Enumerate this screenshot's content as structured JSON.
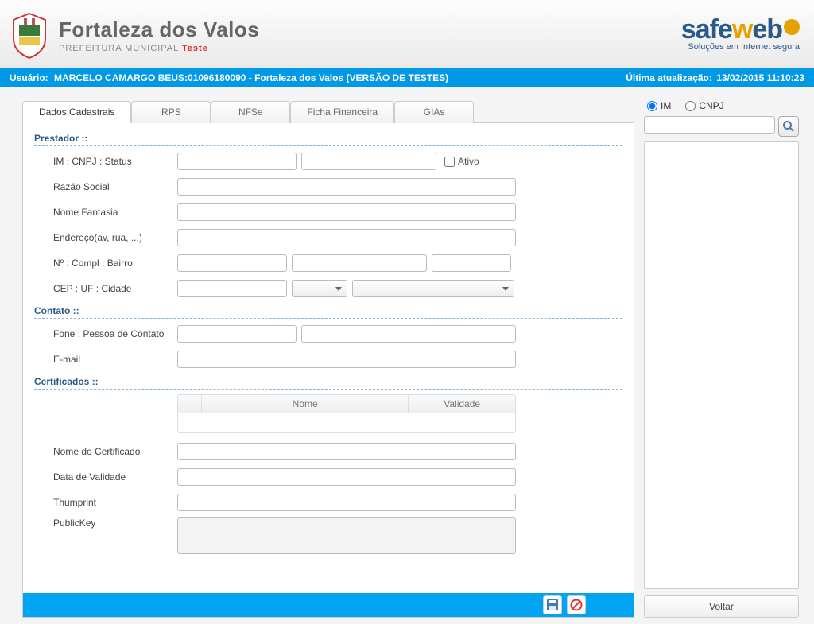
{
  "header": {
    "city": "Fortaleza dos Valos",
    "subtitle_prefix": "PREFEITURA MUNICIPAL",
    "subtitle_badge": "Teste",
    "brand_safe": "safe",
    "brand_w": "w",
    "brand_eb": "eb",
    "brand_tagline": "Soluções em Internet segura"
  },
  "userbar": {
    "label": "Usuário:",
    "user": "MARCELO CAMARGO BEUS:01096180090 - Fortaleza dos Valos (VERSÃO DE TESTES)",
    "updated_label": "Última atualização:",
    "updated_value": "13/02/2015 11:10:23"
  },
  "tabs": {
    "dados": "Dados Cadastrais",
    "rps": "RPS",
    "nfse": "NFSe",
    "ficha": "Ficha Financeira",
    "gias": "GIAs"
  },
  "sections": {
    "prestador": "Prestador ::",
    "contato": "Contato ::",
    "certificados": "Certificados ::"
  },
  "labels": {
    "im_cnpj_status": "IM : CNPJ : Status",
    "ativo": "Ativo",
    "razao": "Razão Social",
    "fantasia": "Nome Fantasia",
    "endereco": "Endereço(av, rua, ...)",
    "num_compl_bairro": "Nº : Compl : Bairro",
    "cep_uf_cidade": "CEP : UF : Cidade",
    "fone_contato": "Fone : Pessoa de Contato",
    "email": "E-mail",
    "nome_cert": "Nome do Certificado",
    "data_validade": "Data de Validade",
    "thumbprint": "Thumprint",
    "publickey": "PublicKey"
  },
  "cert_table": {
    "col_nome": "Nome",
    "col_validade": "Validade"
  },
  "search": {
    "radio_im": "IM",
    "radio_cnpj": "CNPJ",
    "value": ""
  },
  "buttons": {
    "voltar": "Voltar"
  },
  "form_values": {
    "im": "",
    "cnpj": "",
    "ativo": false,
    "razao": "",
    "fantasia": "",
    "endereco": "",
    "numero": "",
    "compl": "",
    "bairro": "",
    "cep": "",
    "uf": "",
    "cidade": "",
    "fone": "",
    "contato": "",
    "email": "",
    "nome_cert": "",
    "data_validade": "",
    "thumbprint": "",
    "publickey": ""
  }
}
